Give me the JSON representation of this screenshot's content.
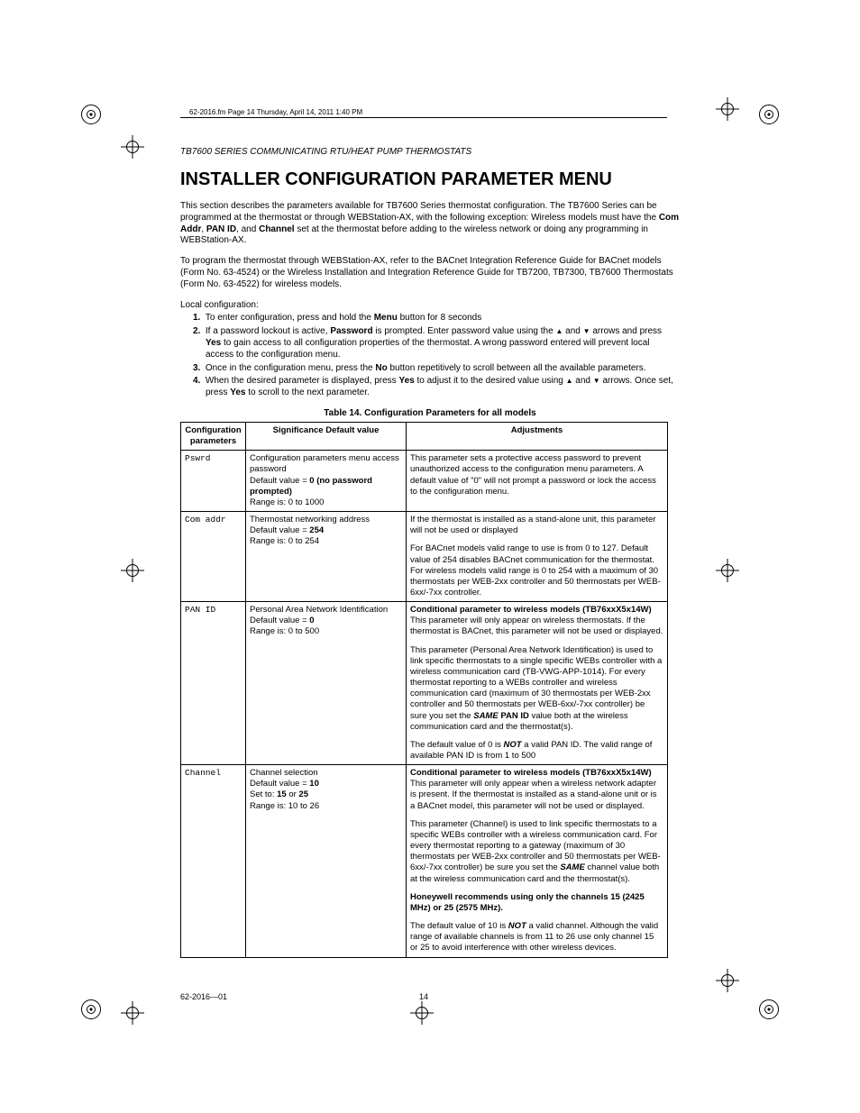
{
  "printers_note": "62-2016.fm  Page 14  Thursday, April 14, 2011  1:40 PM",
  "running_head": "TB7600 SERIES COMMUNICATING RTU/HEAT PUMP THERMOSTATS",
  "heading": "INSTALLER CONFIGURATION PARAMETER MENU",
  "intro_p1_a": "This section describes the parameters available for TB7600 Series thermostat configuration. The TB7600 Series can be programmed at the thermostat or through WEBStation-AX, with the following exception: Wireless models must have the ",
  "intro_p1_b_bold": "Com Addr",
  "intro_p1_c": ", ",
  "intro_p1_d_bold": "PAN ID",
  "intro_p1_e": ", and ",
  "intro_p1_f_bold": "Channel",
  "intro_p1_g": " set at the thermostat before adding to the wireless network or doing any programming in WEBStation-AX.",
  "intro_p2": "To program the thermostat through WEBStation-AX, refer to the BACnet Integration Reference Guide for BACnet models (Form No. 63-4524) or the Wireless Installation and Integration Reference Guide for TB7200, TB7300, TB7600 Thermostats (Form No. 63-4522) for wireless models.",
  "local_cfg_label": "Local configuration:",
  "steps": {
    "s1_a": "To enter configuration, press and hold the ",
    "s1_b_bold": "Menu",
    "s1_c": " button for 8 seconds",
    "s2_a": "If a password lockout is active, ",
    "s2_b_bold": "Password",
    "s2_c": " is prompted. Enter password value using the ",
    "s2_d": " and ",
    "s2_e": " arrows and press ",
    "s2_f_bold": "Yes",
    "s2_g": " to gain access to all configuration properties of the thermostat. A wrong password entered will prevent local access to the configuration menu.",
    "s3_a": "Once in the configuration menu, press the ",
    "s3_b_bold": "No",
    "s3_c": " button repetitively to scroll between all the available parameters.",
    "s4_a": "When the desired parameter is displayed, press ",
    "s4_b_bold": "Yes",
    "s4_c": " to adjust it to the desired value using ",
    "s4_d": " and ",
    "s4_e": " arrows. Once set, press ",
    "s4_f_bold": "Yes",
    "s4_g": " to scroll to the next parameter."
  },
  "table_caption": "Table 14. Configuration Parameters for all models",
  "table": {
    "headers": {
      "col1": "Configuration parameters",
      "col2": "Significance Default value",
      "col3": "Adjustments"
    },
    "rows": {
      "r1": {
        "param": "Pswrd",
        "sig_l1": "Configuration parameters menu access password",
        "sig_l2a": "Default value = ",
        "sig_l2b_bold": "0 (no password prompted)",
        "sig_l3": "Range is: 0 to 1000",
        "adj_p1": "This parameter sets a protective access password to prevent unauthorized access to the configuration menu parameters. A default value of \"0\" will not prompt a password or lock the access to the configuration menu."
      },
      "r2": {
        "param": "Com addr",
        "sig_l1": "Thermostat networking address",
        "sig_l2a": "Default value = ",
        "sig_l2b_bold": "254",
        "sig_l3": "Range is: 0 to 254",
        "adj_p1": "If the thermostat is installed as a stand-alone unit, this parameter will not be used or displayed",
        "adj_p2": "For BACnet models valid range to use is from 0 to 127. Default value of 254 disables BACnet communication for the thermostat. For wireless models valid range is 0 to 254 with a maximum of 30 thermostats per WEB-2xx controller and 50 thermostats per WEB-6xx/-7xx controller."
      },
      "r3": {
        "param": "PAN ID",
        "sig_l1": "Personal Area Network Identification",
        "sig_l2a": "Default value = ",
        "sig_l2b_bold": "0",
        "sig_l3": "Range is: 0 to 500",
        "adj_p1_bold": "Conditional parameter to wireless models (TB76xxX5x14W)",
        "adj_p1_rest": "This parameter will only appear on wireless thermostats. If the thermostat is BACnet, this parameter will not be used or displayed.",
        "adj_p2_a": "This parameter (Personal Area Network Identification) is used to link specific thermostats to a single specific WEBs controller with a wireless communication card (TB-VWG-APP-1014). For every thermostat reporting to a WEBs controller and wireless communication card (maximum of 30 thermostats per WEB-2xx controller and 50 thermostats per WEB-6xx/-7xx controller) be sure you set the ",
        "adj_p2_b_boldital": "SAME",
        "adj_p2_c_bold": " PAN ID",
        "adj_p2_d": " value both at the wireless communication card and the thermostat(s).",
        "adj_p3_a": "The default value of 0 is ",
        "adj_p3_b_boldital": "NOT",
        "adj_p3_c": " a valid PAN ID. The valid range of available PAN ID is from 1 to 500"
      },
      "r4": {
        "param": "Channel",
        "sig_l1": "Channel selection",
        "sig_l2a": "Default value = ",
        "sig_l2b_bold": "10",
        "sig_l3a": "Set to: ",
        "sig_l3b_bold": "15",
        "sig_l3c": " or ",
        "sig_l3d_bold": "25",
        "sig_l4": "Range is: 10 to 26",
        "adj_p1_bold": "Conditional parameter to wireless models (TB76xxX5x14W)",
        "adj_p1_rest": "This parameter will only appear when a wireless network adapter is present. If the thermostat is installed as a stand-alone unit or is a BACnet model, this parameter will not be used or displayed.",
        "adj_p2_a": "This parameter (Channel) is used to link specific thermostats to a specific WEBs controller with a wireless communication card. For every thermostat reporting to a gateway (maximum of 30 thermostats per WEB-2xx controller and 50 thermostats per WEB-6xx/-7xx controller) be sure you set the ",
        "adj_p2_b_boldital": "SAME",
        "adj_p2_c": " channel value both at the wireless communication card and the thermostat(s).",
        "adj_p3_bold": "Honeywell recommends using only the channels 15 (2425 MHz) or 25 (2575 MHz).",
        "adj_p4_a": "The default value of 10 is ",
        "adj_p4_b_boldital": "NOT",
        "adj_p4_c": " a valid channel. Although the valid range of available channels is from 11 to 26 use only channel 15 or 25 to avoid interference with other wireless devices."
      }
    }
  },
  "footer": {
    "docnum": "62-2016—01",
    "pagenum": "14"
  },
  "glyphs": {
    "up": "▲",
    "down": "▼"
  }
}
